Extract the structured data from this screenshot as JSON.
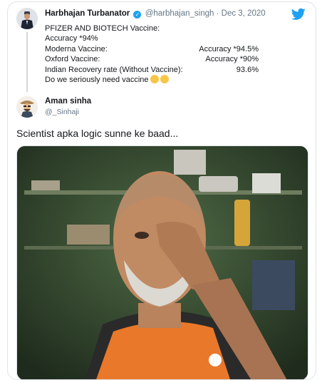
{
  "quoted_tweet": {
    "author_name": "Harbhajan Turbanator",
    "handle": "@harbhajan_singh",
    "separator": "·",
    "date": "Dec 3, 2020",
    "lines": [
      {
        "label": "PFIZER AND BIOTECH Vaccine:",
        "value": ""
      },
      {
        "label": "Accuracy *94%",
        "value": ""
      },
      {
        "label": "Moderna Vaccine:",
        "value": "Accuracy *94.5%"
      },
      {
        "label": "Oxford Vaccine:",
        "value": "Accuracy *90%"
      },
      {
        "label": "Indian Recovery rate (Without Vaccine):",
        "value": "93.6%"
      },
      {
        "label": "Do we seriously need vaccine",
        "value": ""
      }
    ]
  },
  "main_tweet": {
    "author_name": "Aman sinha",
    "handle": "@_Sinhaji",
    "text": "Scientist apka logic sunne ke baad..."
  },
  "icons": {
    "brand": "twitter-bird-icon",
    "verified": "verified-badge-icon",
    "emoji": "thinking-face-emoji"
  },
  "colors": {
    "twitter_blue": "#1da1f2",
    "muted_text": "#657786",
    "border": "#dfe3e8"
  }
}
